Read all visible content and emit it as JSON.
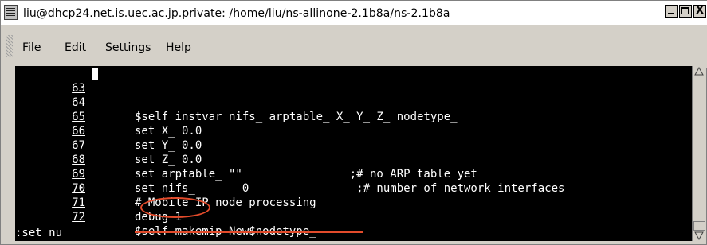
{
  "window": {
    "title": "liu@dhcp24.net.is.uec.ac.jp.private: /home/liu/ns-allinone-2.1b8a/ns-2.1b8a",
    "close_label": "X"
  },
  "menubar": {
    "file": "File",
    "edit": "Edit",
    "settings": "Settings",
    "help": "Help"
  },
  "editor": {
    "lines": [
      {
        "num": "63",
        "code": ""
      },
      {
        "num": "64",
        "code": "$self instvar nifs_ arptable_ X_ Y_ Z_ nodetype_"
      },
      {
        "num": "65",
        "code": "set X_ 0.0"
      },
      {
        "num": "66",
        "code": "set Y_ 0.0"
      },
      {
        "num": "67",
        "code": "set Z_ 0.0"
      },
      {
        "num": "68",
        "code": "set arptable_ \"\"                ;# no ARP table yet"
      },
      {
        "num": "69",
        "code": "set nifs_       0                ;# number of network interfaces"
      },
      {
        "num": "70",
        "code": "# Mobile IP node processing"
      },
      {
        "num": "71",
        "code": "debug 1"
      },
      {
        "num": "72",
        "code": "$self makemip-New$nodetype_"
      }
    ],
    "command": ":set nu"
  },
  "colors": {
    "terminal_bg": "#000000",
    "terminal_fg": "#ffffff",
    "annotation": "#e34b2b",
    "chrome": "#d4d0c8"
  }
}
